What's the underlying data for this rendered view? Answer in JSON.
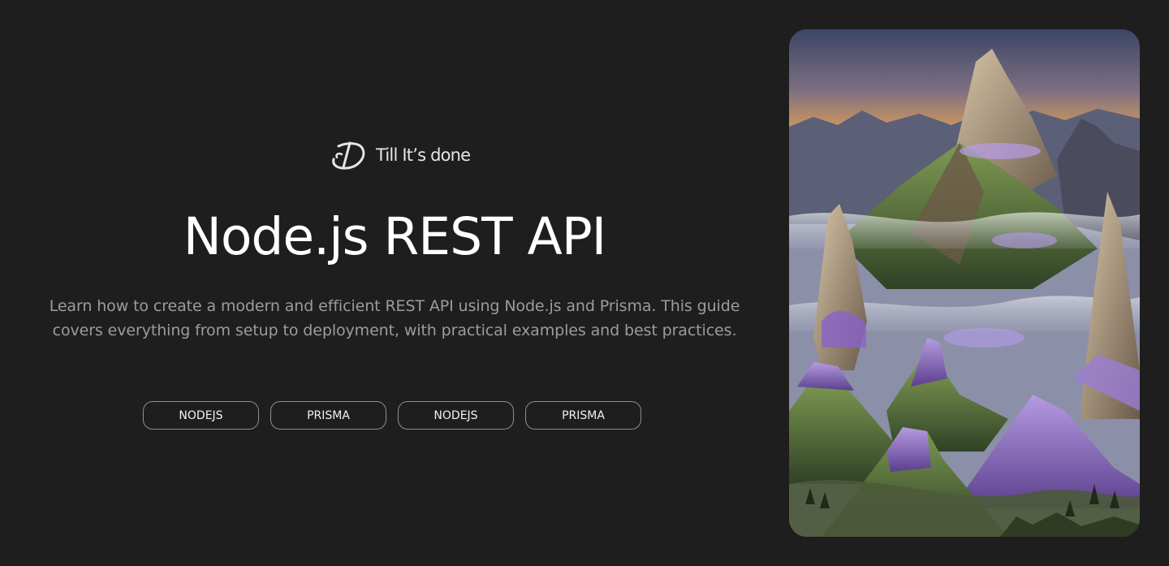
{
  "brand": {
    "name": "Till It’s done",
    "logo_icon": "td-monogram-icon"
  },
  "hero": {
    "title": "Node.js REST API",
    "description": "Learn how to create a modern and efficient REST API using Node.js and Prisma. This guide covers everything from setup to deployment, with practical examples and best practices."
  },
  "tags": [
    {
      "label": "NODEJS"
    },
    {
      "label": "PRISMA"
    },
    {
      "label": "NODEJS"
    },
    {
      "label": "PRISMA"
    }
  ],
  "image": {
    "subject": "mountain-landscape-illustration"
  },
  "colors": {
    "background": "#1e1e1e",
    "text": "#ffffff",
    "muted_text": "#9c9c9c",
    "tag_border": "#8e8e8e",
    "accent_purple": "#8a63c9",
    "accent_green": "#4f6a3a",
    "sky_top": "#3f4a6b",
    "sky_glow": "#e6a15a"
  }
}
